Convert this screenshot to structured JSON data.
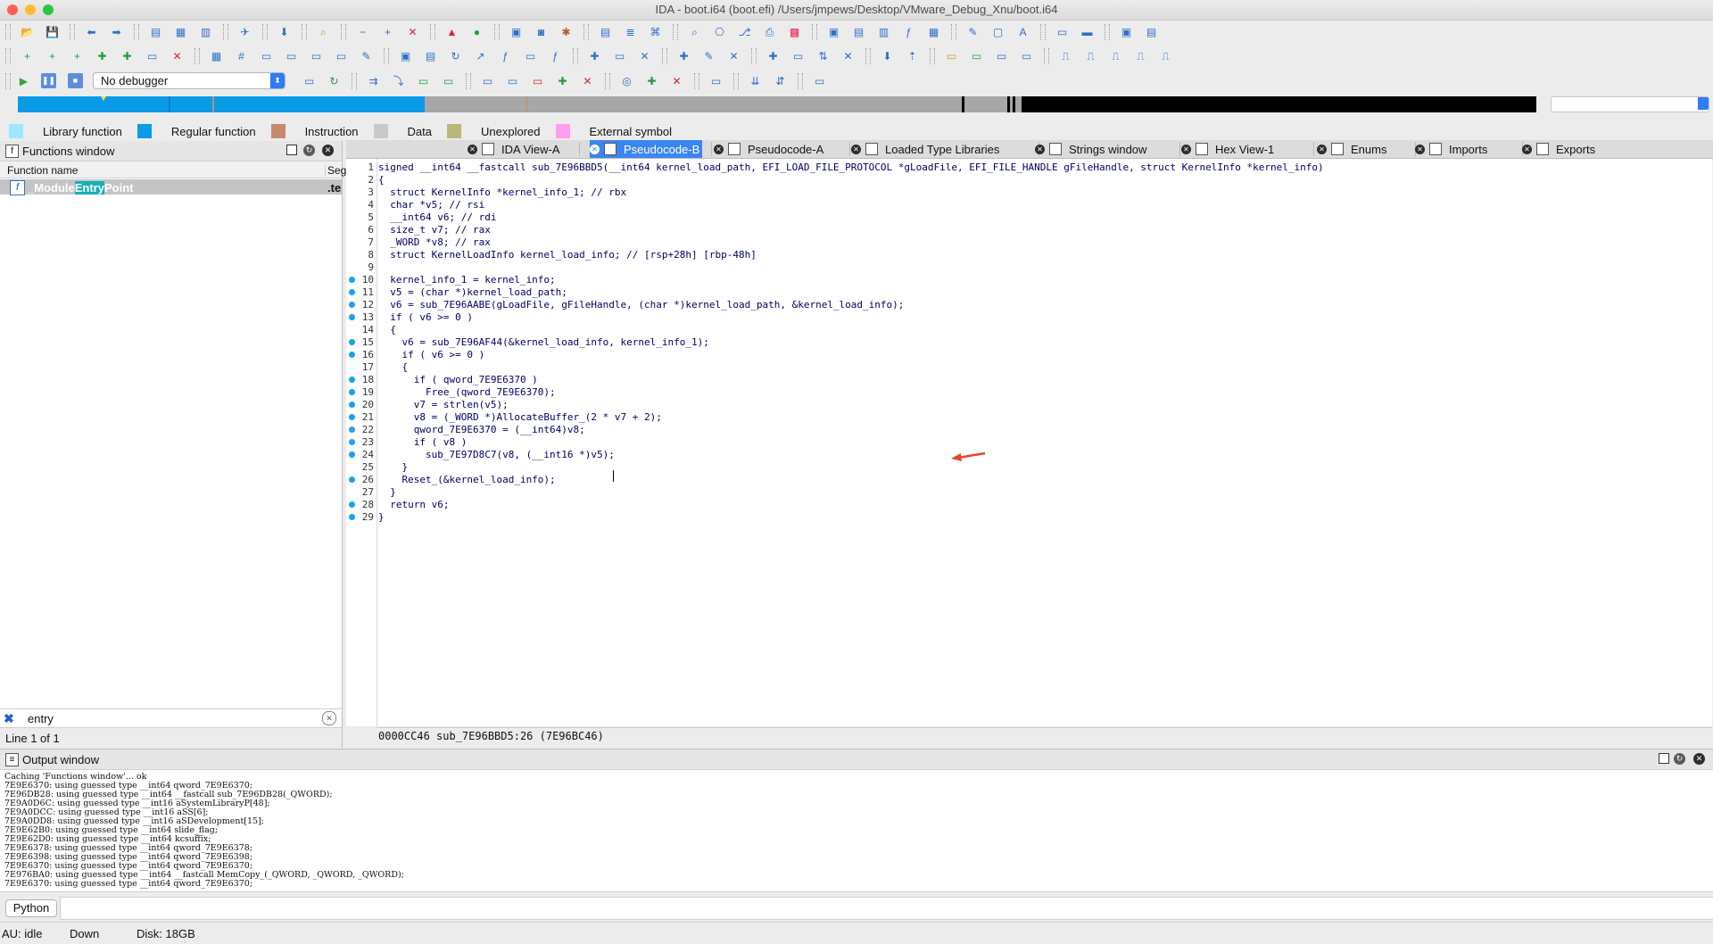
{
  "window": {
    "title": "IDA - boot.i64 (boot.efi) /Users/jmpews/Desktop/VMware_Debug_Xnu/boot.i64"
  },
  "debugger": {
    "selected": "No debugger"
  },
  "legend": [
    {
      "label": "Library function",
      "color": "#9ee8ff"
    },
    {
      "label": "Regular function",
      "color": "#0a9be8"
    },
    {
      "label": "Instruction",
      "color": "#c88a6a"
    },
    {
      "label": "Data",
      "color": "#c9c9c9"
    },
    {
      "label": "Unexplored",
      "color": "#b9b77a"
    },
    {
      "label": "External symbol",
      "color": "#ff9cf0"
    }
  ],
  "functions_window": {
    "title": "Functions window",
    "col_name": "Function name",
    "col_seg": "Seg",
    "row": {
      "pre": "_Module",
      "hit": "Entry",
      "post": "Point",
      "seg": ".te"
    },
    "search_value": "entry",
    "status": "Line 1 of 1"
  },
  "tabs": [
    {
      "label": "IDA View-A",
      "active": false
    },
    {
      "label": "Pseudocode-B",
      "active": true
    },
    {
      "label": "Pseudocode-A",
      "active": false
    },
    {
      "label": "Loaded Type Libraries",
      "active": false
    },
    {
      "label": "Strings window",
      "active": false
    },
    {
      "label": "Hex View-1",
      "active": false
    },
    {
      "label": "Enums",
      "active": false
    },
    {
      "label": "Imports",
      "active": false
    },
    {
      "label": "Exports",
      "active": false
    }
  ],
  "code": {
    "lines": [
      "signed __int64 __fastcall sub_7E96BBD5(__int64 kernel_load_path, EFI_LOAD_FILE_PROTOCOL *gLoadFile, EFI_FILE_HANDLE gFileHandle, struct KernelInfo *kernel_info)",
      "{",
      "  struct KernelInfo *kernel_info_1; // rbx",
      "  char *v5; // rsi",
      "  __int64 v6; // rdi",
      "  size_t v7; // rax",
      "  _WORD *v8; // rax",
      "  struct KernelLoadInfo kernel_load_info; // [rsp+28h] [rbp-48h]",
      "",
      "  kernel_info_1 = kernel_info;",
      "  v5 = (char *)kernel_load_path;",
      "  v6 = sub_7E96AABE(gLoadFile, gFileHandle, (char *)kernel_load_path, &kernel_load_info);",
      "  if ( v6 >= 0 )",
      "  {",
      "    v6 = sub_7E96AF44(&kernel_load_info, kernel_info_1);",
      "    if ( v6 >= 0 )",
      "    {",
      "      if ( qword_7E9E6370 )",
      "        Free_(qword_7E9E6370);",
      "      v7 = strlen(v5);",
      "      v8 = (_WORD *)AllocateBuffer_(2 * v7 + 2);",
      "      qword_7E9E6370 = (__int64)v8;",
      "      if ( v8 )",
      "        sub_7E97D8C7(v8, (__int16 *)v5);",
      "    }",
      "    Reset_(&kernel_load_info);",
      "  }",
      "  return v6;",
      "}"
    ],
    "status": "0000CC46  sub_7E96BBD5:26 (7E96BC46)"
  },
  "output": {
    "title": "Output window",
    "lines": [
      "Caching 'Functions window'... ok",
      "7E9E6370: using guessed type __int64 qword_7E9E6370;",
      "7E96DB28: using guessed type __int64 __fastcall sub_7E96DB28(_QWORD);",
      "7E9A0D6C: using guessed type __int16 aSystemLibraryP[48];",
      "7E9A0DCC: using guessed type __int16 aSS[6];",
      "7E9A0DD8: using guessed type __int16 aSDevelopment[15];",
      "7E9E62B0: using guessed type __int64 slide_flag;",
      "7E9E62D0: using guessed type __int64 kcsuffix;",
      "7E9E6378: using guessed type __int64 qword_7E9E6378;",
      "7E9E6398: using guessed type __int64 qword_7E9E6398;",
      "7E9E6370: using guessed type __int64 qword_7E9E6370;",
      "7E976BA0: using guessed type __int64 __fastcall MemCopy_(_QWORD, _QWORD, _QWORD);",
      "7E9E6370: using guessed type __int64 qword_7E9E6370;"
    ]
  },
  "python": {
    "label": "Python"
  },
  "status": {
    "au": "AU:  idle",
    "dir": "Down",
    "disk": "Disk: 18GB"
  }
}
